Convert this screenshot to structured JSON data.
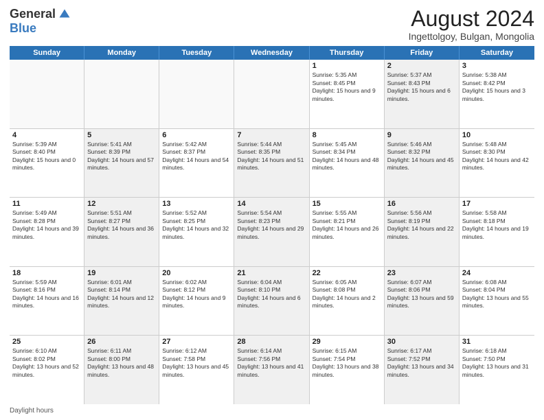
{
  "logo": {
    "general": "General",
    "blue": "Blue"
  },
  "title": "August 2024",
  "subtitle": "Ingettolgoy, Bulgan, Mongolia",
  "days": [
    "Sunday",
    "Monday",
    "Tuesday",
    "Wednesday",
    "Thursday",
    "Friday",
    "Saturday"
  ],
  "weeks": [
    [
      {
        "day": "",
        "text": "",
        "shaded": false,
        "empty": true
      },
      {
        "day": "",
        "text": "",
        "shaded": false,
        "empty": true
      },
      {
        "day": "",
        "text": "",
        "shaded": false,
        "empty": true
      },
      {
        "day": "",
        "text": "",
        "shaded": false,
        "empty": true
      },
      {
        "day": "1",
        "text": "Sunrise: 5:35 AM\nSunset: 8:45 PM\nDaylight: 15 hours and 9 minutes.",
        "shaded": false,
        "empty": false
      },
      {
        "day": "2",
        "text": "Sunrise: 5:37 AM\nSunset: 8:43 PM\nDaylight: 15 hours and 6 minutes.",
        "shaded": true,
        "empty": false
      },
      {
        "day": "3",
        "text": "Sunrise: 5:38 AM\nSunset: 8:42 PM\nDaylight: 15 hours and 3 minutes.",
        "shaded": false,
        "empty": false
      }
    ],
    [
      {
        "day": "4",
        "text": "Sunrise: 5:39 AM\nSunset: 8:40 PM\nDaylight: 15 hours and 0 minutes.",
        "shaded": false,
        "empty": false
      },
      {
        "day": "5",
        "text": "Sunrise: 5:41 AM\nSunset: 8:39 PM\nDaylight: 14 hours and 57 minutes.",
        "shaded": true,
        "empty": false
      },
      {
        "day": "6",
        "text": "Sunrise: 5:42 AM\nSunset: 8:37 PM\nDaylight: 14 hours and 54 minutes.",
        "shaded": false,
        "empty": false
      },
      {
        "day": "7",
        "text": "Sunrise: 5:44 AM\nSunset: 8:35 PM\nDaylight: 14 hours and 51 minutes.",
        "shaded": true,
        "empty": false
      },
      {
        "day": "8",
        "text": "Sunrise: 5:45 AM\nSunset: 8:34 PM\nDaylight: 14 hours and 48 minutes.",
        "shaded": false,
        "empty": false
      },
      {
        "day": "9",
        "text": "Sunrise: 5:46 AM\nSunset: 8:32 PM\nDaylight: 14 hours and 45 minutes.",
        "shaded": true,
        "empty": false
      },
      {
        "day": "10",
        "text": "Sunrise: 5:48 AM\nSunset: 8:30 PM\nDaylight: 14 hours and 42 minutes.",
        "shaded": false,
        "empty": false
      }
    ],
    [
      {
        "day": "11",
        "text": "Sunrise: 5:49 AM\nSunset: 8:28 PM\nDaylight: 14 hours and 39 minutes.",
        "shaded": false,
        "empty": false
      },
      {
        "day": "12",
        "text": "Sunrise: 5:51 AM\nSunset: 8:27 PM\nDaylight: 14 hours and 36 minutes.",
        "shaded": true,
        "empty": false
      },
      {
        "day": "13",
        "text": "Sunrise: 5:52 AM\nSunset: 8:25 PM\nDaylight: 14 hours and 32 minutes.",
        "shaded": false,
        "empty": false
      },
      {
        "day": "14",
        "text": "Sunrise: 5:54 AM\nSunset: 8:23 PM\nDaylight: 14 hours and 29 minutes.",
        "shaded": true,
        "empty": false
      },
      {
        "day": "15",
        "text": "Sunrise: 5:55 AM\nSunset: 8:21 PM\nDaylight: 14 hours and 26 minutes.",
        "shaded": false,
        "empty": false
      },
      {
        "day": "16",
        "text": "Sunrise: 5:56 AM\nSunset: 8:19 PM\nDaylight: 14 hours and 22 minutes.",
        "shaded": true,
        "empty": false
      },
      {
        "day": "17",
        "text": "Sunrise: 5:58 AM\nSunset: 8:18 PM\nDaylight: 14 hours and 19 minutes.",
        "shaded": false,
        "empty": false
      }
    ],
    [
      {
        "day": "18",
        "text": "Sunrise: 5:59 AM\nSunset: 8:16 PM\nDaylight: 14 hours and 16 minutes.",
        "shaded": false,
        "empty": false
      },
      {
        "day": "19",
        "text": "Sunrise: 6:01 AM\nSunset: 8:14 PM\nDaylight: 14 hours and 12 minutes.",
        "shaded": true,
        "empty": false
      },
      {
        "day": "20",
        "text": "Sunrise: 6:02 AM\nSunset: 8:12 PM\nDaylight: 14 hours and 9 minutes.",
        "shaded": false,
        "empty": false
      },
      {
        "day": "21",
        "text": "Sunrise: 6:04 AM\nSunset: 8:10 PM\nDaylight: 14 hours and 6 minutes.",
        "shaded": true,
        "empty": false
      },
      {
        "day": "22",
        "text": "Sunrise: 6:05 AM\nSunset: 8:08 PM\nDaylight: 14 hours and 2 minutes.",
        "shaded": false,
        "empty": false
      },
      {
        "day": "23",
        "text": "Sunrise: 6:07 AM\nSunset: 8:06 PM\nDaylight: 13 hours and 59 minutes.",
        "shaded": true,
        "empty": false
      },
      {
        "day": "24",
        "text": "Sunrise: 6:08 AM\nSunset: 8:04 PM\nDaylight: 13 hours and 55 minutes.",
        "shaded": false,
        "empty": false
      }
    ],
    [
      {
        "day": "25",
        "text": "Sunrise: 6:10 AM\nSunset: 8:02 PM\nDaylight: 13 hours and 52 minutes.",
        "shaded": false,
        "empty": false
      },
      {
        "day": "26",
        "text": "Sunrise: 6:11 AM\nSunset: 8:00 PM\nDaylight: 13 hours and 48 minutes.",
        "shaded": true,
        "empty": false
      },
      {
        "day": "27",
        "text": "Sunrise: 6:12 AM\nSunset: 7:58 PM\nDaylight: 13 hours and 45 minutes.",
        "shaded": false,
        "empty": false
      },
      {
        "day": "28",
        "text": "Sunrise: 6:14 AM\nSunset: 7:56 PM\nDaylight: 13 hours and 41 minutes.",
        "shaded": true,
        "empty": false
      },
      {
        "day": "29",
        "text": "Sunrise: 6:15 AM\nSunset: 7:54 PM\nDaylight: 13 hours and 38 minutes.",
        "shaded": false,
        "empty": false
      },
      {
        "day": "30",
        "text": "Sunrise: 6:17 AM\nSunset: 7:52 PM\nDaylight: 13 hours and 34 minutes.",
        "shaded": true,
        "empty": false
      },
      {
        "day": "31",
        "text": "Sunrise: 6:18 AM\nSunset: 7:50 PM\nDaylight: 13 hours and 31 minutes.",
        "shaded": false,
        "empty": false
      }
    ]
  ],
  "footer": "Daylight hours"
}
